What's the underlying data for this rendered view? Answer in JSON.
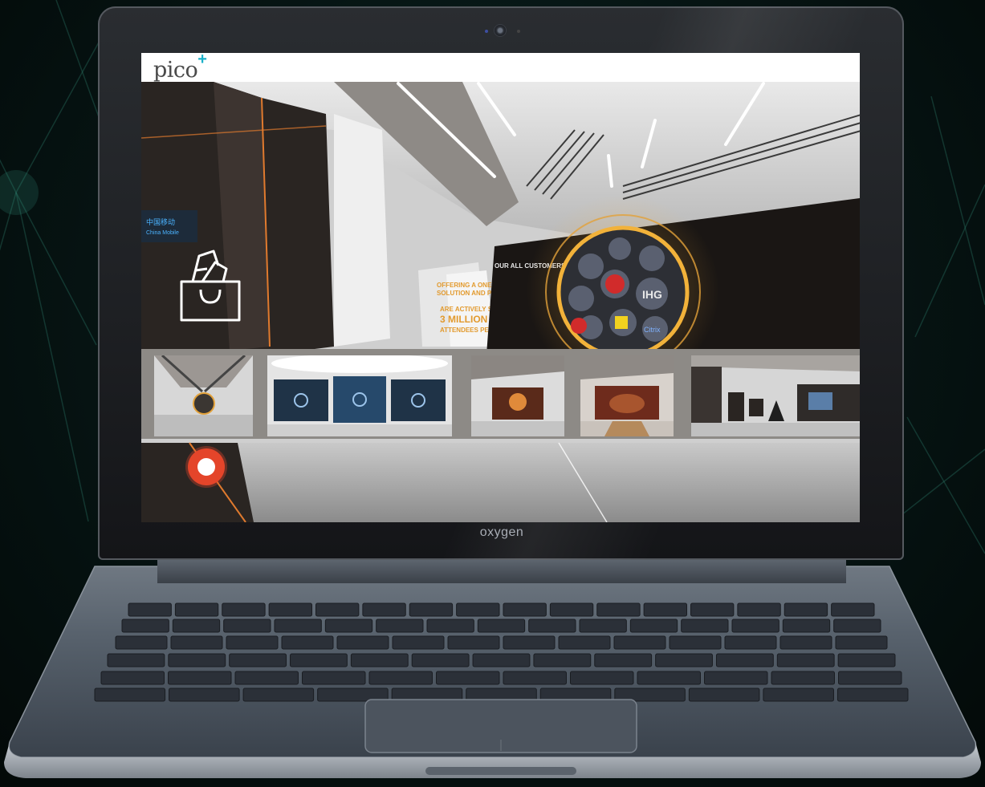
{
  "app": {
    "logo_text": "pico",
    "logo_mark": "+",
    "brand_colors": {
      "logo_text": "#4a4a4a",
      "logo_plus": "#1ab0c8",
      "selection": "#e0792e",
      "record": "#e4452a"
    }
  },
  "laptop": {
    "brand_label": "oxygen"
  },
  "scene": {
    "left_panel_text": [
      "中国移动",
      "China Mobile"
    ],
    "wall_heading": "OUR ALL CUSTOMERS",
    "wall_text": [
      "OFFERING A ONE-STOP",
      "SOLUTION AND PRO",
      "ARE ACTIVELY SEAR",
      "3 MILLION",
      "ATTENDEES PER DA"
    ],
    "globe_logos": [
      "IHG",
      "Citrix"
    ]
  },
  "thumbnails": [
    {
      "icon": "hall-globe",
      "selected": true
    },
    {
      "icon": "screens-hall",
      "selected": false
    },
    {
      "icon": "exhibit-orange",
      "selected": false
    },
    {
      "icon": "exhibit-red",
      "selected": false
    },
    {
      "icon": "corridor-hall",
      "selected": false
    }
  ],
  "icons": {
    "shopping_bag": "shopping-bag-icon",
    "record_button": "record-button-icon"
  }
}
